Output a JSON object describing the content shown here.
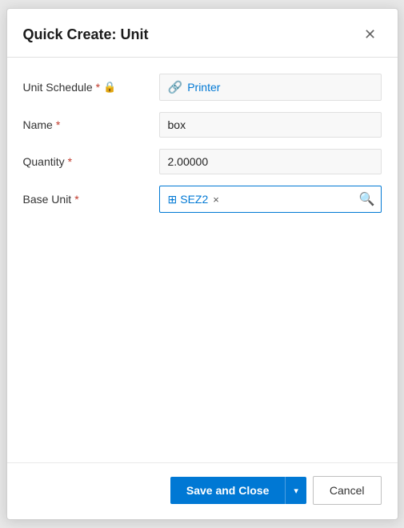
{
  "dialog": {
    "title": "Quick Create: Unit",
    "close_label": "×"
  },
  "fields": {
    "unit_schedule": {
      "label": "Unit Schedule",
      "required": true,
      "locked": true,
      "value": "Printer",
      "link": true,
      "icon": "🔗"
    },
    "name": {
      "label": "Name",
      "required": true,
      "value": "box"
    },
    "quantity": {
      "label": "Quantity",
      "required": true,
      "value": "2.00000"
    },
    "base_unit": {
      "label": "Base Unit",
      "required": true,
      "value": "SEZ2"
    }
  },
  "footer": {
    "save_label": "Save and Close",
    "dropdown_icon": "▾",
    "cancel_label": "Cancel"
  },
  "icons": {
    "close": "✕",
    "lock": "🔒",
    "unit_link": "🔗",
    "lookup_entity": "⊞",
    "search": "🔍",
    "remove": "×",
    "chevron_down": "▾"
  }
}
